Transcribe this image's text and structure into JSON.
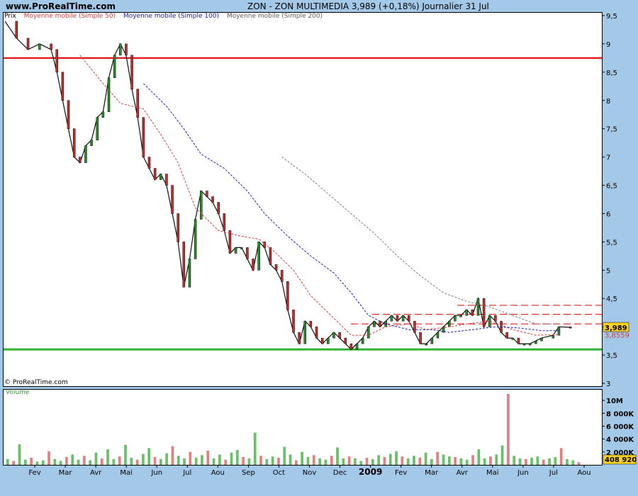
{
  "header": {
    "site": "www.ProRealTime.com",
    "title": "ZON - ZON MULTIMEDIA    3,989 (+0,18%)    Journalier  31 Jul"
  },
  "legend": {
    "price": "Prix",
    "ma50": "Moyenne mobile (Simple 50)",
    "ma100": "Moyenne mobile (Simple 100)",
    "ma200": "Moyenne mobile (Simple 200)"
  },
  "copyright": "© ProRealTime.com",
  "volume_label": "Volume",
  "colors": {
    "ma50": "#d04040",
    "ma100": "#2020b0",
    "ma200": "#808080",
    "up_candle": "#2e8b2e",
    "down_candle": "#c03030",
    "resistance": "#e00000",
    "support": "#30b030"
  },
  "chart_data": {
    "type": "line",
    "x_ticks": [
      "Fev",
      "Mar",
      "Avr",
      "Mai",
      "Jun",
      "Jul",
      "Aou",
      "Sep",
      "Oct",
      "Nov",
      "Dec",
      "2009",
      "Fev",
      "Mar",
      "Avr",
      "Mai",
      "Jun",
      "Jul",
      "Aou"
    ],
    "y_ticks": [
      "9,5",
      "9",
      "8,5",
      "8",
      "7,5",
      "7",
      "6,5",
      "6",
      "5,5",
      "5",
      "4,5",
      "4",
      "3,5",
      "3"
    ],
    "ylim": [
      2.95,
      9.55
    ],
    "last_price_label": "3,989",
    "ma_label": "3,8559",
    "volume_ticks": [
      "10M",
      "8 000K",
      "6 000K",
      "4 000K",
      "2 000K"
    ],
    "last_volume_label": "408 920",
    "support_level": 3.6,
    "resistance_level": 8.75,
    "dashed_levels": [
      4.38,
      4.22,
      4.05
    ],
    "series": [
      {
        "name": "Prix",
        "points": [
          [
            0.0,
            9.4
          ],
          [
            0.02,
            9.1
          ],
          [
            0.04,
            8.9
          ],
          [
            0.06,
            9.0
          ],
          [
            0.08,
            8.9
          ],
          [
            0.09,
            8.5
          ],
          [
            0.1,
            8.0
          ],
          [
            0.11,
            7.5
          ],
          [
            0.12,
            7.0
          ],
          [
            0.13,
            6.9
          ],
          [
            0.14,
            7.2
          ],
          [
            0.15,
            7.3
          ],
          [
            0.16,
            7.7
          ],
          [
            0.17,
            7.8
          ],
          [
            0.18,
            8.4
          ],
          [
            0.19,
            8.8
          ],
          [
            0.2,
            9.0
          ],
          [
            0.21,
            8.8
          ],
          [
            0.22,
            8.2
          ],
          [
            0.23,
            7.7
          ],
          [
            0.24,
            7.0
          ],
          [
            0.25,
            6.8
          ],
          [
            0.26,
            6.6
          ],
          [
            0.27,
            6.7
          ],
          [
            0.28,
            6.5
          ],
          [
            0.29,
            6.0
          ],
          [
            0.3,
            5.5
          ],
          [
            0.31,
            4.7
          ],
          [
            0.32,
            5.2
          ],
          [
            0.33,
            5.9
          ],
          [
            0.34,
            6.4
          ],
          [
            0.35,
            6.3
          ],
          [
            0.36,
            6.2
          ],
          [
            0.37,
            6.0
          ],
          [
            0.38,
            5.7
          ],
          [
            0.39,
            5.3
          ],
          [
            0.4,
            5.4
          ],
          [
            0.41,
            5.4
          ],
          [
            0.42,
            5.2
          ],
          [
            0.43,
            5.0
          ],
          [
            0.44,
            5.5
          ],
          [
            0.45,
            5.4
          ],
          [
            0.46,
            5.1
          ],
          [
            0.47,
            5.0
          ],
          [
            0.48,
            4.8
          ],
          [
            0.49,
            4.3
          ],
          [
            0.5,
            3.9
          ],
          [
            0.51,
            3.7
          ],
          [
            0.52,
            4.1
          ],
          [
            0.53,
            4.0
          ],
          [
            0.54,
            3.8
          ],
          [
            0.55,
            3.7
          ],
          [
            0.56,
            3.8
          ],
          [
            0.57,
            3.9
          ],
          [
            0.58,
            3.8
          ],
          [
            0.59,
            3.7
          ],
          [
            0.6,
            3.6
          ],
          [
            0.61,
            3.7
          ],
          [
            0.62,
            3.8
          ],
          [
            0.63,
            4.0
          ],
          [
            0.64,
            4.1
          ],
          [
            0.65,
            4.0
          ],
          [
            0.66,
            4.1
          ],
          [
            0.67,
            4.2
          ],
          [
            0.68,
            4.1
          ],
          [
            0.69,
            4.2
          ],
          [
            0.7,
            4.1
          ],
          [
            0.71,
            3.9
          ],
          [
            0.72,
            3.7
          ],
          [
            0.73,
            3.7
          ],
          [
            0.74,
            3.8
          ],
          [
            0.75,
            3.9
          ],
          [
            0.76,
            4.0
          ],
          [
            0.77,
            4.1
          ],
          [
            0.78,
            4.2
          ],
          [
            0.79,
            4.2
          ],
          [
            0.8,
            4.3
          ],
          [
            0.81,
            4.2
          ],
          [
            0.82,
            4.5
          ],
          [
            0.83,
            4.0
          ],
          [
            0.84,
            4.2
          ],
          [
            0.85,
            4.1
          ],
          [
            0.86,
            3.9
          ],
          [
            0.87,
            3.8
          ],
          [
            0.88,
            3.8
          ],
          [
            0.89,
            3.7
          ],
          [
            0.9,
            3.7
          ],
          [
            0.91,
            3.7
          ],
          [
            0.92,
            3.75
          ],
          [
            0.93,
            3.8
          ],
          [
            0.95,
            3.85
          ],
          [
            0.96,
            4.0
          ],
          [
            0.98,
            3.99
          ]
        ]
      },
      {
        "name": "Moyenne mobile (Simple 50)",
        "points": [
          [
            0.13,
            8.8
          ],
          [
            0.17,
            8.3
          ],
          [
            0.2,
            7.95
          ],
          [
            0.24,
            7.85
          ],
          [
            0.27,
            7.4
          ],
          [
            0.3,
            6.9
          ],
          [
            0.33,
            6.1
          ],
          [
            0.37,
            5.7
          ],
          [
            0.41,
            5.6
          ],
          [
            0.44,
            5.55
          ],
          [
            0.47,
            5.3
          ],
          [
            0.5,
            5.0
          ],
          [
            0.53,
            4.55
          ],
          [
            0.57,
            4.15
          ],
          [
            0.6,
            3.85
          ],
          [
            0.63,
            3.85
          ],
          [
            0.66,
            4.0
          ],
          [
            0.7,
            4.05
          ],
          [
            0.73,
            3.95
          ],
          [
            0.77,
            4.0
          ],
          [
            0.8,
            4.05
          ],
          [
            0.84,
            4.1
          ],
          [
            0.88,
            3.95
          ],
          [
            0.92,
            3.85
          ],
          [
            0.96,
            3.86
          ]
        ]
      },
      {
        "name": "Moyenne mobile (Simple 100)",
        "points": [
          [
            0.24,
            8.3
          ],
          [
            0.28,
            7.9
          ],
          [
            0.31,
            7.5
          ],
          [
            0.34,
            7.05
          ],
          [
            0.38,
            6.8
          ],
          [
            0.42,
            6.4
          ],
          [
            0.45,
            6.0
          ],
          [
            0.49,
            5.6
          ],
          [
            0.53,
            5.25
          ],
          [
            0.57,
            4.95
          ],
          [
            0.6,
            4.6
          ],
          [
            0.63,
            4.2
          ],
          [
            0.66,
            4.05
          ],
          [
            0.7,
            3.95
          ],
          [
            0.74,
            3.95
          ],
          [
            0.77,
            3.9
          ],
          [
            0.81,
            3.95
          ],
          [
            0.85,
            4.0
          ],
          [
            0.89,
            3.98
          ],
          [
            0.93,
            3.93
          ],
          [
            0.96,
            3.93
          ]
        ]
      },
      {
        "name": "Moyenne mobile (Simple 200)",
        "points": [
          [
            0.48,
            7.0
          ],
          [
            0.52,
            6.7
          ],
          [
            0.56,
            6.35
          ],
          [
            0.6,
            6.0
          ],
          [
            0.64,
            5.65
          ],
          [
            0.68,
            5.25
          ],
          [
            0.72,
            4.9
          ],
          [
            0.76,
            4.6
          ],
          [
            0.8,
            4.45
          ],
          [
            0.84,
            4.35
          ],
          [
            0.88,
            4.2
          ],
          [
            0.92,
            4.05
          ],
          [
            0.96,
            4.05
          ]
        ]
      }
    ],
    "volume_series": {
      "name": "Volume",
      "values": [
        0.9,
        0.6,
        3.2,
        0.8,
        1.1,
        0.5,
        0.7,
        2.1,
        0.9,
        0.6,
        1.2,
        1.6,
        0.8,
        1.4,
        0.7,
        1.9,
        1.0,
        2.4,
        0.9,
        1.3,
        3.1,
        1.1,
        0.8,
        1.7,
        2.6,
        1.2,
        0.9,
        1.8,
        2.9,
        1.4,
        1.0,
        2.0,
        1.1,
        1.5,
        2.2,
        1.0,
        1.6,
        0.8,
        1.9,
        2.3,
        1.2,
        1.0,
        5.0,
        1.4,
        0.9,
        1.3,
        1.1,
        2.8,
        1.6,
        0.7,
        2.0,
        1.2,
        1.5,
        1.0,
        0.8,
        1.4,
        2.7,
        1.0,
        1.3,
        1.0,
        0.6,
        1.1,
        0.9,
        1.5,
        1.2,
        1.7,
        2.1,
        1.3,
        1.0,
        1.4,
        1.1,
        1.9,
        0.9,
        2.0,
        1.6,
        1.3,
        1.2,
        1.0,
        0.8,
        1.5,
        2.4,
        1.0,
        1.3,
        1.6,
        3.0,
        11.0,
        1.4,
        1.0,
        0.9,
        1.1,
        1.3,
        0.8,
        1.0,
        1.2,
        2.6,
        0.9,
        0.7,
        0.4
      ]
    }
  }
}
